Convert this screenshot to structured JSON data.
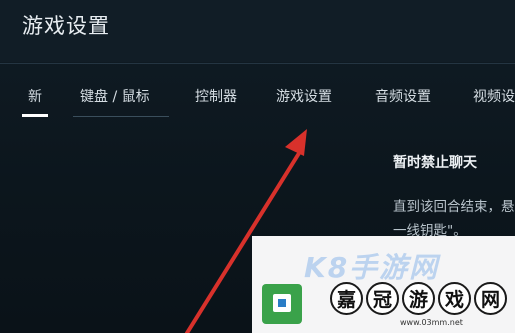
{
  "header": {
    "title": "游戏设置"
  },
  "tabs": [
    {
      "label": "新",
      "active": true
    },
    {
      "label": "键盘 / 鼠标",
      "active": false
    },
    {
      "label": "控制器",
      "active": false
    },
    {
      "label": "游戏设置",
      "active": false
    },
    {
      "label": "音频设置",
      "active": false
    },
    {
      "label": "视频设",
      "active": false
    }
  ],
  "panel": {
    "heading": "暂时禁止聊天",
    "description": "直到该回合结束，悬一线钥匙\"。"
  },
  "watermark": {
    "brand_ghost": "K8手游网",
    "brand_chars": [
      "嘉",
      "冠",
      "游",
      "戏",
      "网"
    ],
    "url": "www.03mm.net"
  },
  "colors": {
    "background": "#0f1a22",
    "annotation_arrow": "#d8312b",
    "logo_green": "#3aa24a",
    "logo_blue": "#2a7dc6"
  }
}
